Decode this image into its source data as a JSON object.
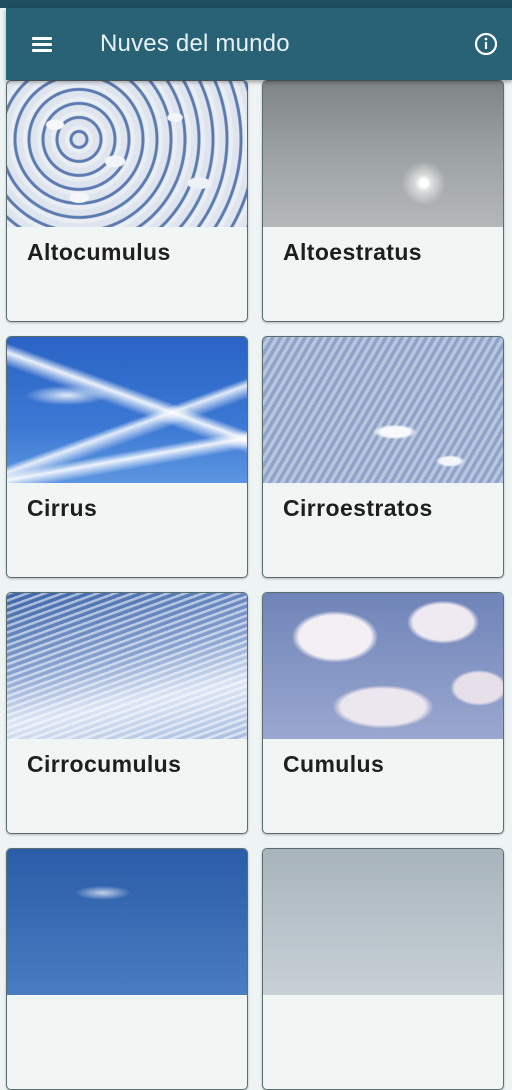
{
  "app_bar": {
    "title": "Nuves del mundo",
    "menu_icon": "menu-icon",
    "info_icon": "info-icon"
  },
  "colors": {
    "app_bar": "#2a6275",
    "status_bar": "#1f4f5f",
    "card_background": "#f1f6f5",
    "page_background": "#eef3f3"
  },
  "clouds": [
    {
      "name": "Altocumulus"
    },
    {
      "name": "Altoestratus"
    },
    {
      "name": "Cirrus"
    },
    {
      "name": "Cirroestratos"
    },
    {
      "name": "Cirrocumulus"
    },
    {
      "name": "Cumulus"
    },
    {
      "name": ""
    },
    {
      "name": ""
    }
  ]
}
